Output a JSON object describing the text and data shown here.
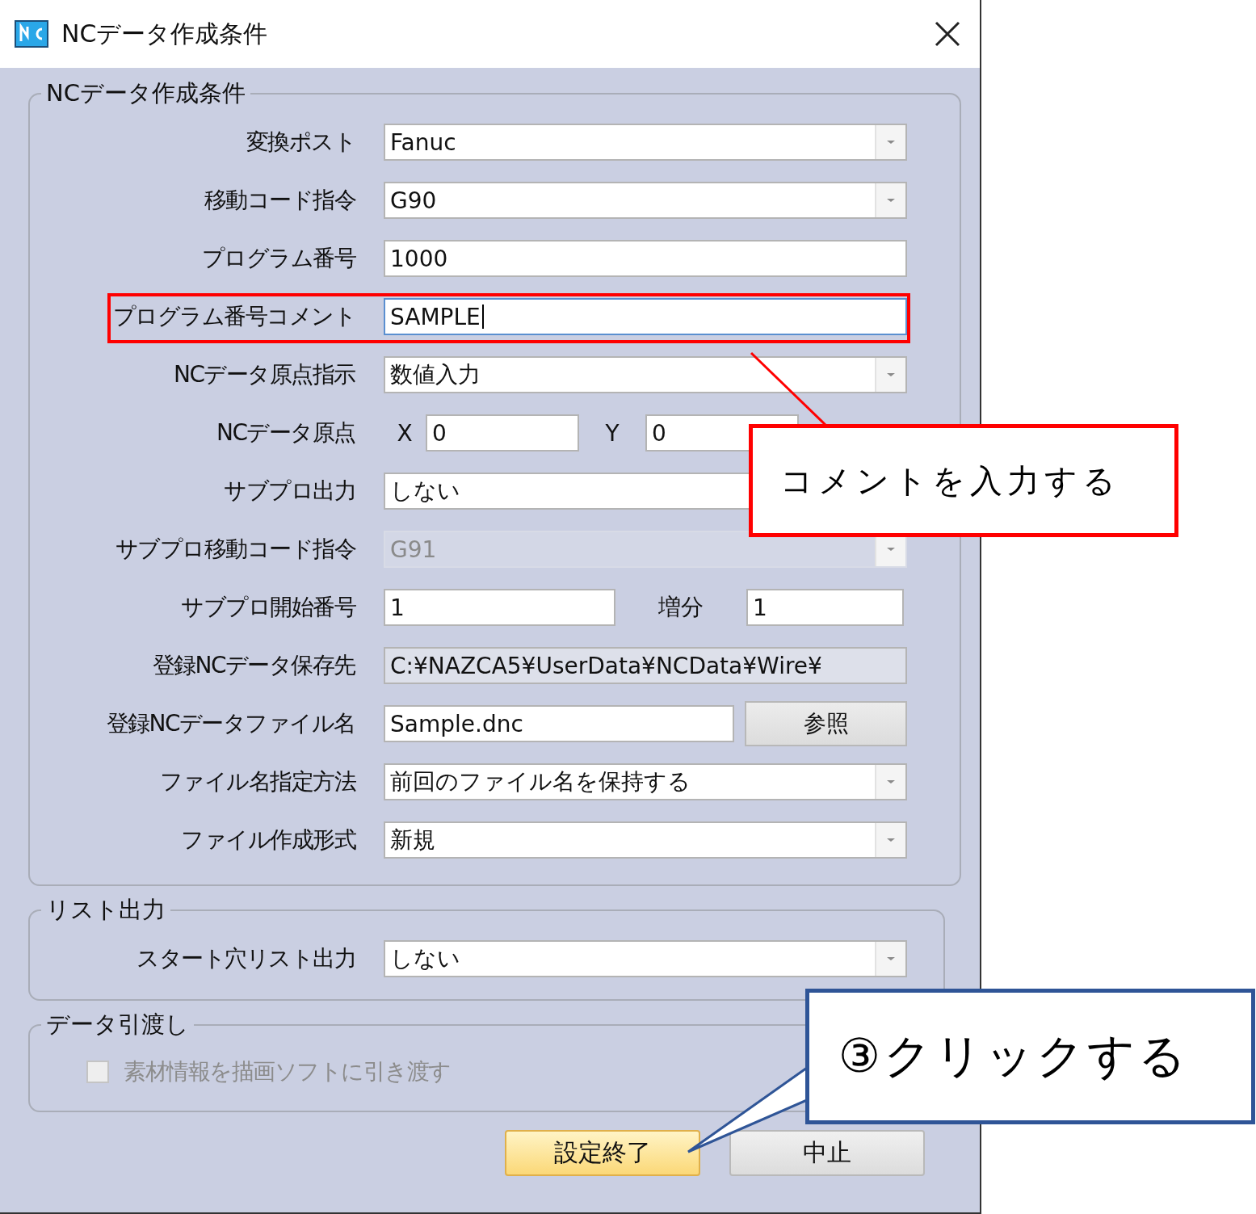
{
  "window": {
    "title": "NCデータ作成条件"
  },
  "groups": [
    {
      "legend": "NCデータ作成条件",
      "rows": [
        {
          "kind": "select",
          "label": "変換ポスト",
          "value": "Fanuc",
          "disabled": false,
          "highlighted": false
        },
        {
          "kind": "select",
          "label": "移動コード指令",
          "value": "G90",
          "disabled": false,
          "highlighted": false
        },
        {
          "kind": "text",
          "label": "プログラム番号",
          "value": "1000",
          "focused": false,
          "highlighted": false
        },
        {
          "kind": "text",
          "label": "プログラム番号コメント",
          "value": "SAMPLE",
          "focused": true,
          "highlighted": true
        },
        {
          "kind": "select",
          "label": "NCデータ原点指示",
          "value": "数値入力",
          "disabled": false,
          "highlighted": false
        },
        {
          "kind": "xy",
          "label": "NCデータ原点",
          "x_label": "X",
          "x_value": "0",
          "y_label": "Y",
          "y_value": "0"
        },
        {
          "kind": "select",
          "label": "サブプロ出力",
          "value": "しない",
          "disabled": false,
          "highlighted": false
        },
        {
          "kind": "select",
          "label": "サブプロ移動コード指令",
          "value": "G91",
          "disabled": true,
          "highlighted": false
        },
        {
          "kind": "pair",
          "label": "サブプロ開始番号",
          "value": "1",
          "second_label": "増分",
          "second_value": "1"
        },
        {
          "kind": "readonly",
          "label": "登録NCデータ保存先",
          "value": "C:¥NAZCA5¥UserData¥NCData¥Wire¥"
        },
        {
          "kind": "browse",
          "label": "登録NCデータファイル名",
          "value": "Sample.dnc",
          "button": "参照"
        },
        {
          "kind": "select",
          "label": "ファイル名指定方法",
          "value": "前回のファイル名を保持する",
          "disabled": false,
          "highlighted": false
        },
        {
          "kind": "select",
          "label": "ファイル作成形式",
          "value": "新規",
          "disabled": false,
          "highlighted": false
        }
      ]
    },
    {
      "legend": "リスト出力",
      "rows": [
        {
          "kind": "select",
          "label": "スタート穴リスト出力",
          "value": "しない",
          "disabled": false,
          "highlighted": false
        }
      ]
    },
    {
      "legend": "データ引渡し",
      "rows": [
        {
          "kind": "checkbox",
          "label": "素材情報を描画ソフトに引き渡す",
          "checked": false,
          "disabled": true
        }
      ]
    }
  ],
  "buttons": [
    {
      "label": "設定終了",
      "primary": true
    },
    {
      "label": "中止",
      "primary": false
    }
  ],
  "callouts": [
    {
      "text": "コメントを入力する",
      "color": "#ff0000"
    },
    {
      "text": "③クリックする",
      "color": "#2f5597"
    }
  ]
}
